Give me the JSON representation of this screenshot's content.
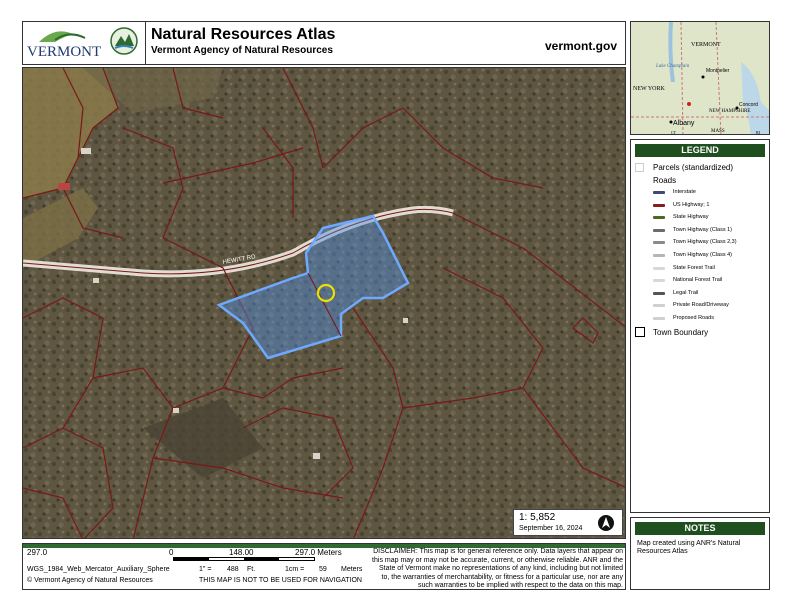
{
  "header": {
    "logo_word": "VERMONT",
    "title": "Natural Resources Atlas",
    "subtitle": "Vermont Agency of Natural Resources",
    "site": "vermont.gov"
  },
  "map": {
    "road_label": "HEWITT RD",
    "scale_ratio": "1:  5,852",
    "date": "September 16, 2024"
  },
  "overview": {
    "labels": [
      "VERMONT",
      "Lake Champlain",
      "Montpelier",
      "NEW YORK",
      "NEW HAMPSHIRE",
      "Concord",
      "Albany",
      "MASS",
      "CT",
      "RI"
    ]
  },
  "scalebar": {
    "left_value": "297.0",
    "mid_zero": "0",
    "mid_value": "148.00",
    "right_value": "297.0 Meters",
    "projection": "WGS_1984_Web_Mercator_Auxiliary_Sphere",
    "inch_prefix": "1\" =",
    "inch_value": "488",
    "inch_unit": "Ft.",
    "cm_prefix": "1cm =",
    "cm_value": "59",
    "cm_unit": "Meters",
    "copyright": "© Vermont Agency of Natural Resources",
    "navigation_note": "THIS MAP IS NOT TO BE USED FOR NAVIGATION"
  },
  "disclaimer": "DISCLAIMER: This map is for general reference only. Data layers that appear on this map may or may not be accurate, current, or otherwise reliable. ANR and the State of Vermont make no representations of any kind, including but not limited to, the warranties of merchantability, or fitness for a particular use, nor are any such warranties to be implied with respect to the data on this map.",
  "legend": {
    "title": "LEGEND",
    "parcels": "Parcels (standardized)",
    "roads": "Roads",
    "road_items": [
      {
        "label": "Interstate",
        "color": "#3b4a7a"
      },
      {
        "label": "US Highway; 1",
        "color": "#8b1a1a"
      },
      {
        "label": "State Highway",
        "color": "#4a6b1e"
      },
      {
        "label": "Town Highway (Class 1)",
        "color": "#6b6b6b"
      },
      {
        "label": "Town Highway (Class 2,3)",
        "color": "#8a8a8a"
      },
      {
        "label": "Town Highway (Class 4)",
        "color": "#b5b5b5"
      },
      {
        "label": "State Forest Trail",
        "color": "#d8d8d8"
      },
      {
        "label": "National Forest Trail",
        "color": "#d8d8d8"
      },
      {
        "label": "Legal Trail",
        "color": "#555555"
      },
      {
        "label": "Private Road/Driveway",
        "color": "#cfcfcf"
      },
      {
        "label": "Proposed Roads",
        "color": "#cfcfcf"
      }
    ],
    "town_boundary": "Town Boundary"
  },
  "notes": {
    "title": "NOTES",
    "text": "Map created using ANR's Natural Resources Atlas"
  },
  "colors": {
    "accent_green": "#1f4e1f",
    "parcel_line": "#7a1818",
    "selection": "#4f8fe0",
    "marker": "#f0e000"
  }
}
